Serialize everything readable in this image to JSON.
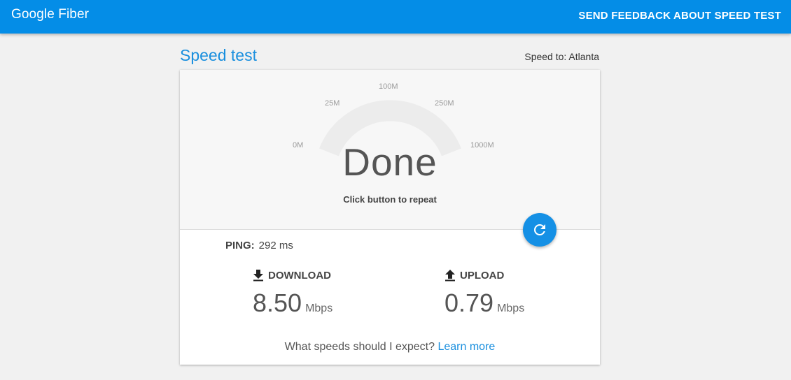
{
  "header": {
    "brand": "Google Fiber",
    "feedback_link": "SEND FEEDBACK ABOUT SPEED TEST"
  },
  "page": {
    "title": "Speed test",
    "speed_to": "Speed to: Atlanta"
  },
  "gauge": {
    "ticks": [
      "0M",
      "25M",
      "100M",
      "250M",
      "1000M"
    ],
    "status": "Done",
    "hint": "Click button to repeat"
  },
  "results": {
    "ping_label": "PING:",
    "ping_value": "292 ms",
    "download_label": "DOWNLOAD",
    "download_value": "8.50",
    "download_unit": "Mbps",
    "upload_label": "UPLOAD",
    "upload_value": "0.79",
    "upload_unit": "Mbps"
  },
  "footer": {
    "question": "What speeds should I expect?",
    "learn_more": "Learn more"
  },
  "colors": {
    "accent": "#048de7",
    "link": "#1a8fde"
  },
  "icons": {
    "refresh": "refresh-icon",
    "download": "download-icon",
    "upload": "upload-icon"
  }
}
